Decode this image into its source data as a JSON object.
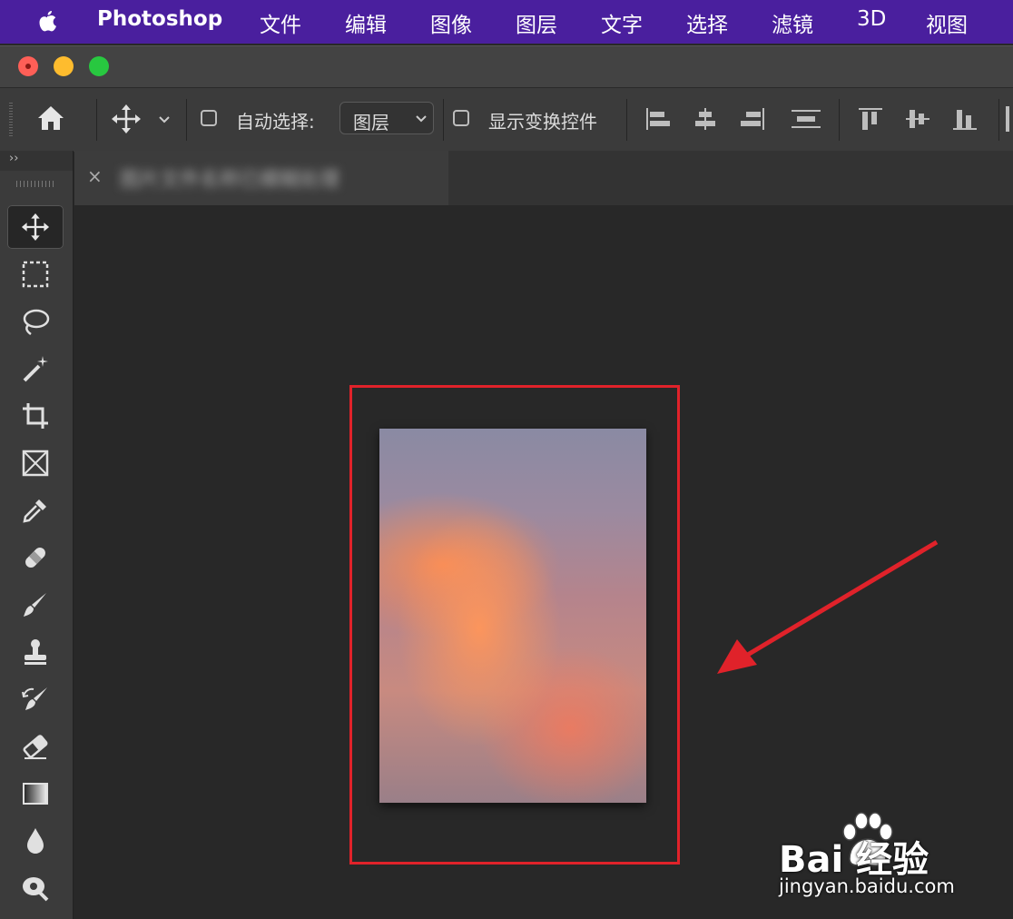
{
  "menubar": {
    "app_name": "Photoshop",
    "items": [
      "文件",
      "编辑",
      "图像",
      "图层",
      "文字",
      "选择",
      "滤镜",
      "3D",
      "视图"
    ]
  },
  "options_bar": {
    "auto_select_label": "自动选择:",
    "auto_select_checked": false,
    "auto_select_target": "图层",
    "show_transform_label": "显示变换控件",
    "show_transform_checked": false
  },
  "toolbar": {
    "collapse_glyph": "››",
    "tools": [
      "move",
      "rectangular-marquee",
      "lasso",
      "magic-wand",
      "crop",
      "frame",
      "eyedropper",
      "healing-brush",
      "brush",
      "clone-stamp",
      "history-brush",
      "eraser",
      "gradient",
      "blur",
      "dodge"
    ],
    "active_tool": "move"
  },
  "document_tab": {
    "close_glyph": "×",
    "name": "图片文件名称已模糊处理"
  },
  "watermark": {
    "brand": "Bai 经验",
    "site": "jingyan.baidu.com"
  },
  "colors": {
    "menubar_bg": "#4a1f9e",
    "annotation_red": "#e0222a",
    "canvas_bg": "#282828",
    "panel_bg": "#3b3b3b"
  }
}
